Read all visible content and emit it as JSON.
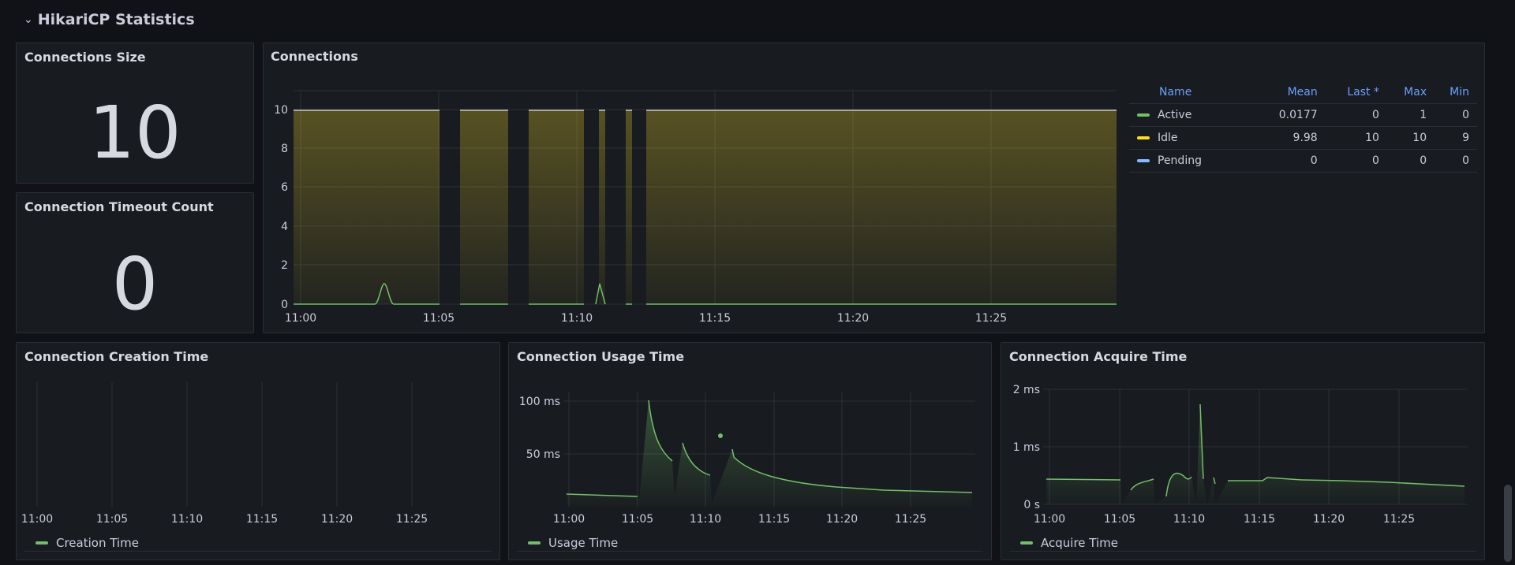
{
  "row": {
    "title": "HikariCP Statistics",
    "collapse_icon": "chevron-down-icon"
  },
  "colors": {
    "active": "#73bf69",
    "idle": "#fade2a",
    "pending": "#8ab8ff",
    "header": "#6e9fff"
  },
  "stat_size": {
    "title": "Connections Size",
    "value": "10"
  },
  "stat_timeout": {
    "title": "Connection Timeout Count",
    "value": "0"
  },
  "connections": {
    "title": "Connections",
    "legend": {
      "headers": [
        "Name",
        "Mean",
        "Last *",
        "Max",
        "Min"
      ],
      "rows": [
        {
          "name": "Active",
          "mean": "0.0177",
          "last": "0",
          "max": "1",
          "min": "0"
        },
        {
          "name": "Idle",
          "mean": "9.98",
          "last": "10",
          "max": "10",
          "min": "9"
        },
        {
          "name": "Pending",
          "mean": "0",
          "last": "0",
          "max": "0",
          "min": "0"
        }
      ]
    }
  },
  "creation": {
    "title": "Connection Creation Time",
    "legend_label": "Creation Time"
  },
  "usage": {
    "title": "Connection Usage Time",
    "legend_label": "Usage Time"
  },
  "acquire": {
    "title": "Connection Acquire Time",
    "legend_label": "Acquire Time"
  },
  "chart_data": [
    {
      "type": "area",
      "title": "Connections",
      "x_ticks": [
        "11:00",
        "11:05",
        "11:10",
        "11:15",
        "11:20",
        "11:25"
      ],
      "y_ticks": [
        "0",
        "2",
        "4",
        "6",
        "8",
        "10"
      ],
      "ylim": [
        0,
        10.5
      ],
      "series": [
        {
          "name": "Idle",
          "summary": "constant 10 with brief gaps near 11:05, 11:08, 11:10, 11:11, 11:12"
        },
        {
          "name": "Active",
          "peaks": [
            {
              "x": "11:03",
              "y": 1
            },
            {
              "x": "11:10",
              "y": 1
            }
          ]
        },
        {
          "name": "Pending",
          "constant": 0
        }
      ]
    },
    {
      "type": "line",
      "title": "Connection Creation Time",
      "x_ticks": [
        "11:00",
        "11:05",
        "11:10",
        "11:15",
        "11:20",
        "11:25"
      ],
      "series": [
        {
          "name": "Creation Time",
          "values": []
        }
      ]
    },
    {
      "type": "line",
      "title": "Connection Usage Time",
      "x_ticks": [
        "11:00",
        "11:05",
        "11:10",
        "11:15",
        "11:20",
        "11:25"
      ],
      "y_ticks": [
        "50 ms",
        "100 ms"
      ],
      "series": [
        {
          "name": "Usage Time",
          "x": [
            "11:00",
            "11:03",
            "11:05",
            "11:06",
            "11:08",
            "11:10",
            "11:12",
            "11:15",
            "11:20",
            "11:25",
            "11:29"
          ],
          "y_ms": [
            12,
            11,
            10,
            100,
            55,
            28,
            35,
            22,
            16,
            13,
            12
          ]
        }
      ]
    },
    {
      "type": "line",
      "title": "Connection Acquire Time",
      "x_ticks": [
        "11:00",
        "11:05",
        "11:10",
        "11:15",
        "11:20",
        "11:25"
      ],
      "y_ticks": [
        "0 s",
        "1 ms",
        "2 ms"
      ],
      "series": [
        {
          "name": "Acquire Time",
          "x": [
            "11:00",
            "11:05",
            "11:07",
            "11:09",
            "11:10",
            "11:12",
            "11:15",
            "11:20",
            "11:25",
            "11:29"
          ],
          "y_ms": [
            0.45,
            0.44,
            0.4,
            0.55,
            1.75,
            0.42,
            0.42,
            0.38,
            0.36,
            0.34
          ]
        }
      ]
    }
  ]
}
